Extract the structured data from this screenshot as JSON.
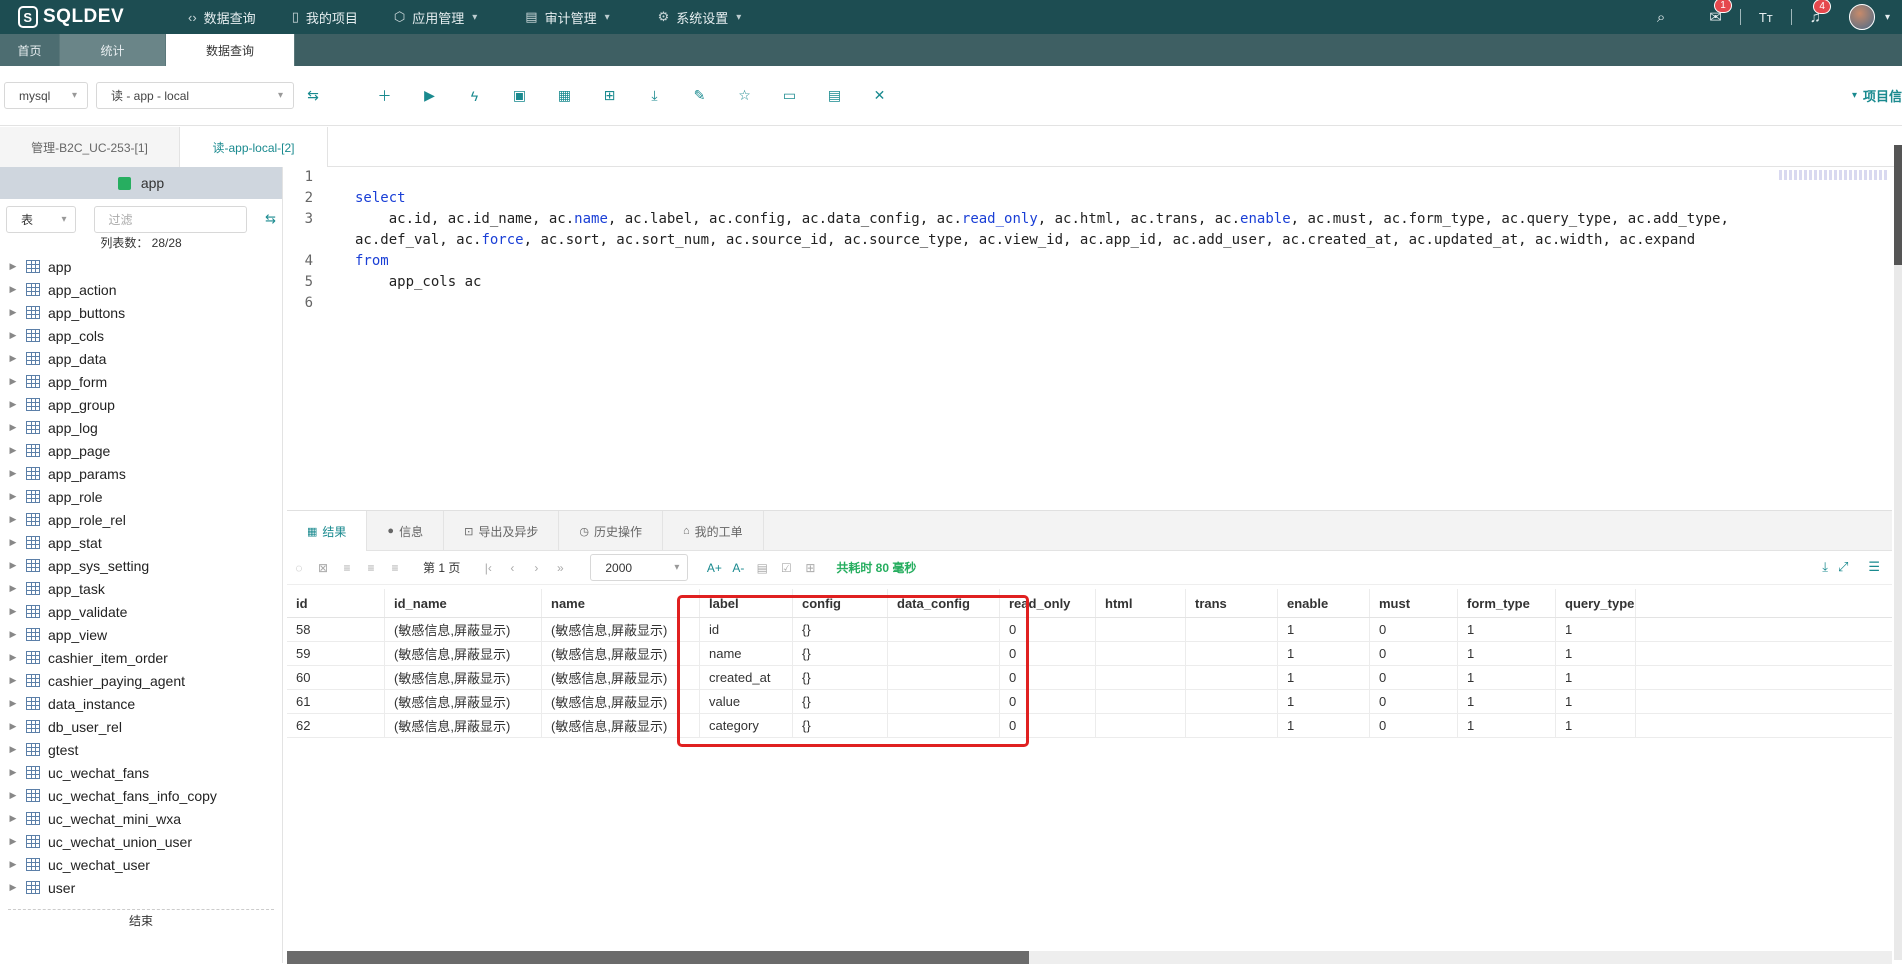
{
  "app": {
    "logo": "SQLDEV"
  },
  "nav": [
    {
      "label": "数据查询",
      "icon": "code-icon",
      "has_menu": false
    },
    {
      "label": "我的项目",
      "icon": "book-icon",
      "has_menu": false
    },
    {
      "label": "应用管理",
      "icon": "cube-icon",
      "has_menu": true
    },
    {
      "label": "审计管理",
      "icon": "doc-icon",
      "has_menu": true
    },
    {
      "label": "系统设置",
      "icon": "gear-icon",
      "has_menu": true
    }
  ],
  "top_right": {
    "messages_badge": "1",
    "notifications_badge": "4"
  },
  "page_tabs": [
    "首页",
    "统计",
    "数据查询"
  ],
  "toolbar": {
    "db_type": "mysql",
    "connection": "读 - app - local",
    "project_info": "项目信"
  },
  "query_tabs": [
    "管理-B2C_UC-253-[1]",
    "读-app-local-[2]"
  ],
  "sidebar": {
    "db_name": "app",
    "type_select": "表",
    "filter_placeholder": "过滤",
    "table_count": "列表数： 28/28",
    "tables": [
      "app",
      "app_action",
      "app_buttons",
      "app_cols",
      "app_data",
      "app_form",
      "app_group",
      "app_log",
      "app_page",
      "app_params",
      "app_role",
      "app_role_rel",
      "app_stat",
      "app_sys_setting",
      "app_task",
      "app_validate",
      "app_view",
      "cashier_item_order",
      "cashier_paying_agent",
      "data_instance",
      "db_user_rel",
      "gtest",
      "uc_wechat_fans",
      "uc_wechat_fans_info_copy",
      "uc_wechat_mini_wxa",
      "uc_wechat_union_user",
      "uc_wechat_user",
      "user"
    ],
    "end_label": "结束"
  },
  "editor": {
    "line_numbers": [
      "1",
      "2",
      "",
      "3",
      "",
      "4",
      "5",
      "6"
    ],
    "kw_select": "select",
    "line3a_1": "    ac.id, ac.id_name, ac.",
    "line3a_kw1": "name",
    "line3a_2": ", ac.label, ac.config, ac.data_config, ac.",
    "line3a_kw2": "read_only",
    "line3a_3": ", ac.html, ac.trans, ac.",
    "line3a_kw3": "enable",
    "line3a_4": ", ac.must, ac.form_type, ac.query_type, ac.add_type,",
    "line3b_1": "ac.def_val, ac.",
    "line3b_kw": "force",
    "line3b_2": ", ac.sort, ac.sort_num, ac.source_id, ac.source_type, ac.view_id, ac.app_id, ac.add_user, ac.created_at, ac.updated_at, ac.width, ac.expand",
    "kw_from": "from",
    "line5": "    app_cols ac"
  },
  "results": {
    "tabs": [
      {
        "label": "结果",
        "icon": "grid-icon"
      },
      {
        "label": "信息",
        "icon": "info-icon"
      },
      {
        "label": "导出及异步",
        "icon": "export-icon"
      },
      {
        "label": "历史操作",
        "icon": "clock-icon"
      },
      {
        "label": "我的工单",
        "icon": "ticket-icon"
      }
    ],
    "page_label": "第 1 页",
    "page_size": "2000",
    "timing": "共耗时 80 毫秒",
    "columns": [
      "id",
      "id_name",
      "name",
      "label",
      "config",
      "data_config",
      "read_only",
      "html",
      "trans",
      "enable",
      "must",
      "form_type",
      "query_type"
    ],
    "rows": [
      [
        "58",
        "(敏感信息,屏蔽显示)",
        "(敏感信息,屏蔽显示)",
        "id",
        "{}",
        "",
        "0",
        "",
        "",
        "1",
        "0",
        "1",
        "1"
      ],
      [
        "59",
        "(敏感信息,屏蔽显示)",
        "(敏感信息,屏蔽显示)",
        "name",
        "{}",
        "",
        "0",
        "",
        "",
        "1",
        "0",
        "1",
        "1"
      ],
      [
        "60",
        "(敏感信息,屏蔽显示)",
        "(敏感信息,屏蔽显示)",
        "created_at",
        "{}",
        "",
        "0",
        "",
        "",
        "1",
        "0",
        "1",
        "1"
      ],
      [
        "61",
        "(敏感信息,屏蔽显示)",
        "(敏感信息,屏蔽显示)",
        "value",
        "{}",
        "",
        "0",
        "",
        "",
        "1",
        "0",
        "1",
        "1"
      ],
      [
        "62",
        "(敏感信息,屏蔽显示)",
        "(敏感信息,屏蔽显示)",
        "category",
        "{}",
        "",
        "0",
        "",
        "",
        "1",
        "0",
        "1",
        "1"
      ]
    ]
  },
  "colors": {
    "topbar": "#1d4d52",
    "accent": "#1a8a8f",
    "highlight": "#e02020",
    "timing": "#27ae60"
  }
}
